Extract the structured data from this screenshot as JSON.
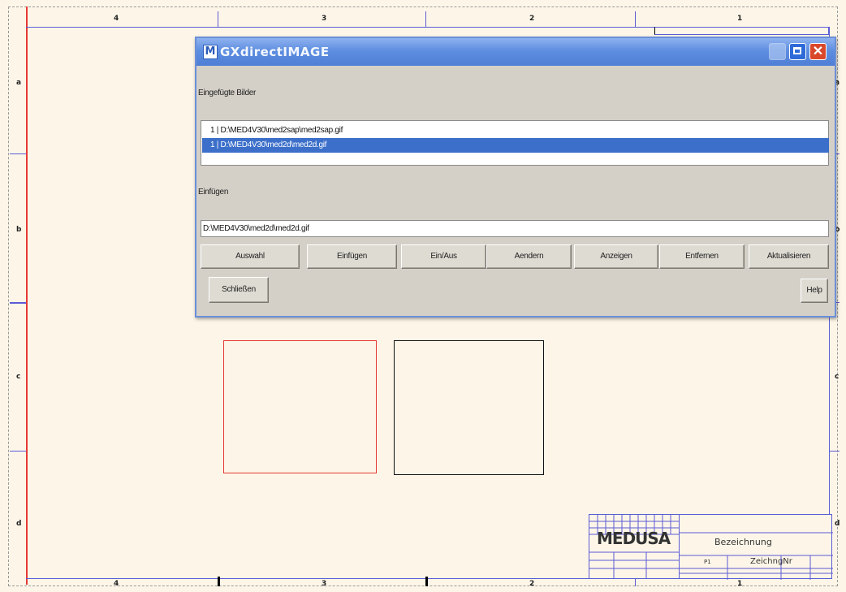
{
  "ruler": {
    "top": [
      "4",
      "3",
      "2",
      "1"
    ],
    "bottom": [
      "4",
      "3",
      "2",
      "1"
    ],
    "left": [
      "a",
      "b",
      "c",
      "d"
    ],
    "right": [
      "a",
      "b",
      "c",
      "d"
    ]
  },
  "dialog": {
    "title": "GXdirectIMAGE",
    "icon_letter": "M",
    "inserted_label": "Eingefügte Bilder",
    "list_items": [
      {
        "text": "1 | D:\\MED4V30\\med2sap\\med2sap.gif",
        "selected": false
      },
      {
        "text": "1 | D:\\MED4V30\\med2d\\med2d.gif",
        "selected": true
      }
    ],
    "insert_label": "Einfügen",
    "path_value": "D:\\MED4V30\\med2d\\med2d.gif",
    "buttons": {
      "auswahl": "Auswahl",
      "einfuegen": "Einfügen",
      "einaus": "Ein/Aus",
      "aendern": "Aendern",
      "anzeigen": "Anzeigen",
      "entfernen": "Entfernen",
      "aktualisieren": "Aktualisieren",
      "schliessen": "Schließen",
      "help": "Help"
    },
    "close_glyph": "✕"
  },
  "title_block": {
    "logo": "MEDUSA",
    "designation": "Bezeichnung",
    "drawing_no": "ZeichngNr",
    "scale_cell": "P1"
  },
  "colors": {
    "frame": "#5b5bd6",
    "sheet_border": "#e53935",
    "titlebar": "#4f7fd5",
    "selection": "#3b6fc9",
    "paper": "#fdf6e8"
  }
}
